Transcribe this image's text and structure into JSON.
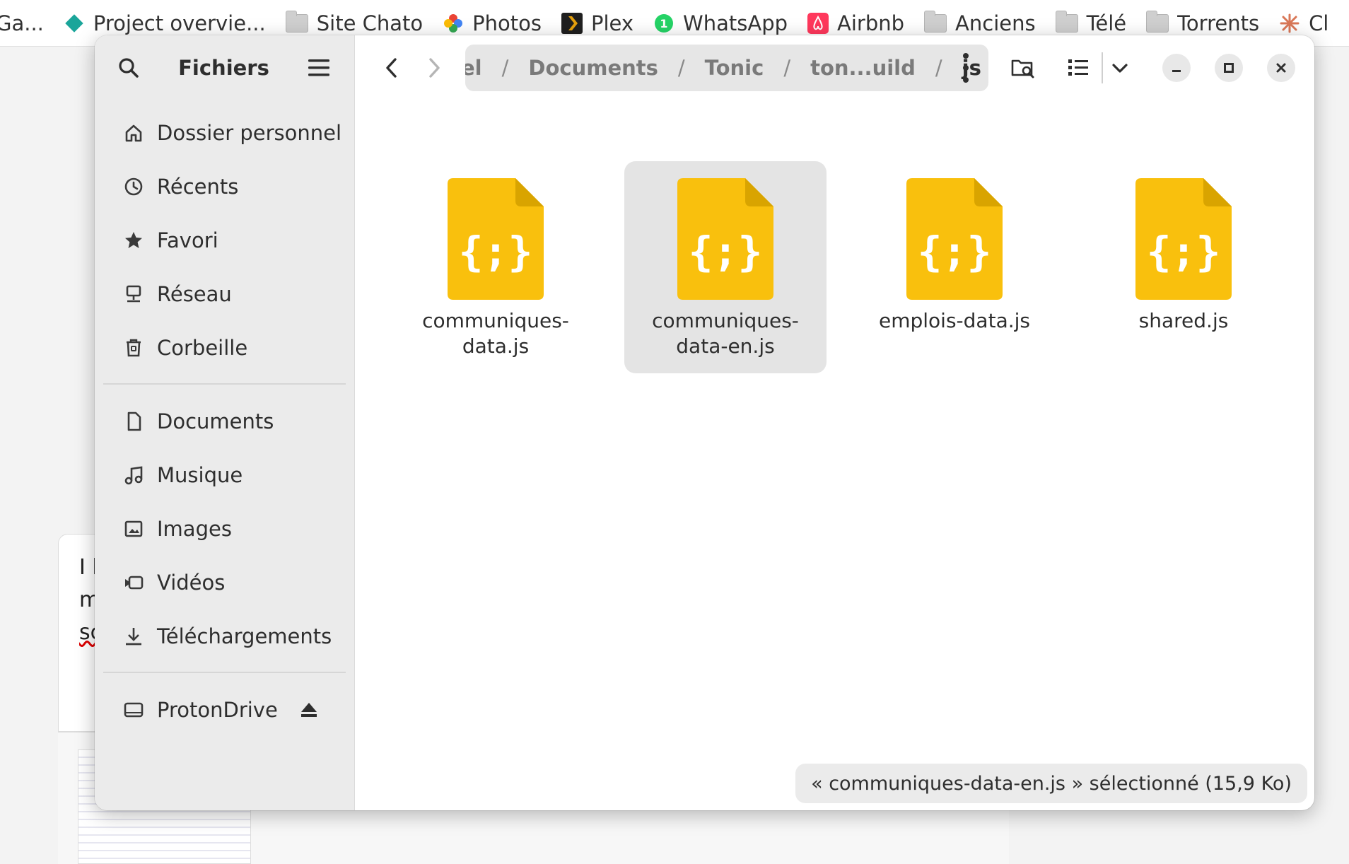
{
  "bookmarks": [
    {
      "label": "Ga...",
      "icon": "partial"
    },
    {
      "label": "Project overvie...",
      "icon": "diamond-icon"
    },
    {
      "label": "Site Chato",
      "icon": "folder-icon"
    },
    {
      "label": "Photos",
      "icon": "photos-icon"
    },
    {
      "label": "Plex",
      "icon": "plex-icon"
    },
    {
      "label": "WhatsApp",
      "icon": "whatsapp-icon"
    },
    {
      "label": "Airbnb",
      "icon": "airbnb-icon"
    },
    {
      "label": "Anciens",
      "icon": "folder-icon"
    },
    {
      "label": "Télé",
      "icon": "folder-icon"
    },
    {
      "label": "Torrents",
      "icon": "folder-icon"
    },
    {
      "label": "Cl",
      "icon": "claude-icon"
    }
  ],
  "whatsapp_badge": "1",
  "background_text": [
    "I l",
    "m",
    "sc"
  ],
  "sidebar": {
    "title": "Fichiers",
    "places": [
      {
        "label": "Dossier personnel",
        "icon": "home-icon"
      },
      {
        "label": "Récents",
        "icon": "clock-icon"
      },
      {
        "label": "Favori",
        "icon": "star-icon"
      },
      {
        "label": "Réseau",
        "icon": "network-icon"
      },
      {
        "label": "Corbeille",
        "icon": "trash-icon"
      }
    ],
    "bookmarks": [
      {
        "label": "Documents",
        "icon": "document-icon"
      },
      {
        "label": "Musique",
        "icon": "music-icon"
      },
      {
        "label": "Images",
        "icon": "image-icon"
      },
      {
        "label": "Vidéos",
        "icon": "video-icon"
      },
      {
        "label": "Téléchargements",
        "icon": "download-icon"
      }
    ],
    "drives": [
      {
        "label": "ProtonDrive",
        "icon": "drive-icon"
      }
    ]
  },
  "path": {
    "crumbs": [
      "el",
      "Documents",
      "Tonic",
      "ton...uild",
      "js"
    ],
    "separator": "/"
  },
  "files": [
    {
      "name": "communiques-data.js",
      "selected": false
    },
    {
      "name": "communiques-data-en.js",
      "selected": true
    },
    {
      "name": "emplois-data.js",
      "selected": false
    },
    {
      "name": "shared.js",
      "selected": false
    }
  ],
  "file_glyph": "{;}",
  "status": "« communiques-data-en.js » sélectionné  (15,9 Ko)",
  "colors": {
    "js_icon": "#f9c00d",
    "js_icon_fold": "#d9a400",
    "selection": "#e4e4e4"
  }
}
